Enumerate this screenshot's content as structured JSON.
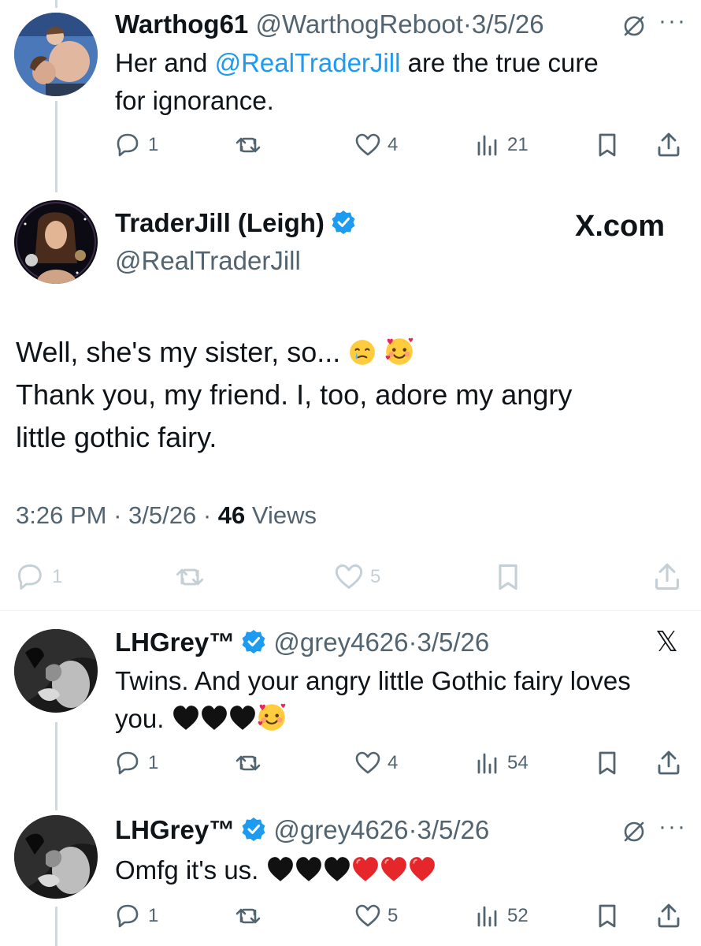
{
  "tweet1": {
    "name": "Warthog61",
    "handle": "@WarthogReboot",
    "date": "3/5/26",
    "text_a": "Her and ",
    "mention": "@RealTraderJill",
    "text_b": " are the true cure",
    "text_c": "for ignorance.",
    "replies": "1",
    "likes": "4",
    "views": "21"
  },
  "main": {
    "name": "TraderJill (Leigh)",
    "handle": "@RealTraderJill",
    "brand": "X.com",
    "line1": "Well, she's my sister, so...",
    "line2": "Thank you, my friend. I, too, adore my angry",
    "line3": "little gothic fairy.",
    "time": "3:26 PM",
    "date": "3/5/26",
    "views_count": "46",
    "views_label": "Views",
    "replies": "1",
    "likes": "5"
  },
  "tweet3": {
    "name": "LHGrey™",
    "handle": "@grey4626",
    "date": "3/5/26",
    "line1": "Twins. And your angry little Gothic fairy loves",
    "line2": "you.",
    "replies": "1",
    "likes": "4",
    "views": "54"
  },
  "tweet4": {
    "name": "LHGrey™",
    "handle": "@grey4626",
    "date": "3/5/26",
    "line1": "Omfg it's us.",
    "replies": "1",
    "likes": "5",
    "views": "52"
  },
  "icons": {
    "reply": "reply-icon",
    "retweet": "retweet-icon",
    "like": "heart-icon",
    "views": "views-icon",
    "bookmark": "bookmark-icon",
    "share": "share-icon",
    "verified": "verified-badge-icon",
    "grok": "grok-icon",
    "more": "more-icon"
  },
  "colors": {
    "accent": "#1d9bf0",
    "muted": "#536471",
    "text": "#0f1419"
  }
}
